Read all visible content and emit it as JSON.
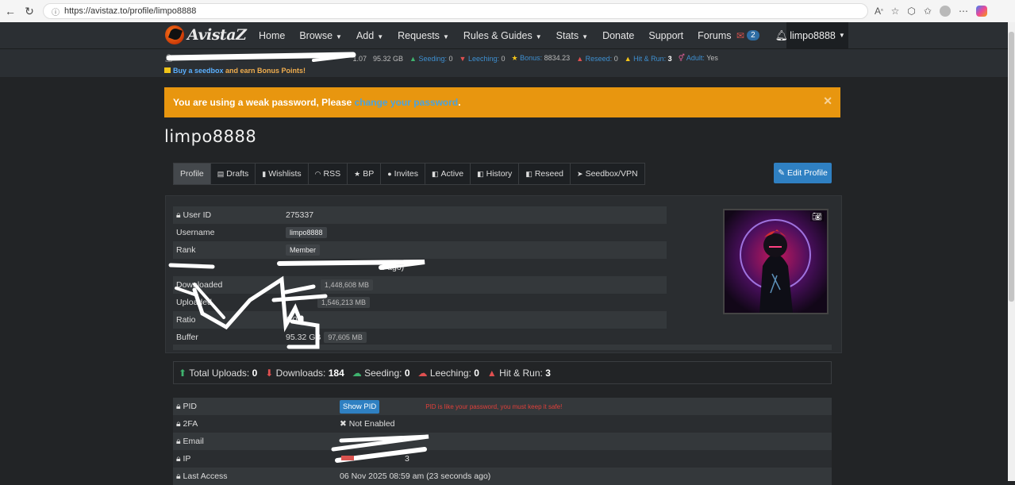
{
  "browser": {
    "url": "https://avistaz.to/profile/limpo8888"
  },
  "site": {
    "logo_text": "AvistaZ",
    "menu": [
      {
        "label": "Home",
        "caret": false
      },
      {
        "label": "Browse",
        "caret": true
      },
      {
        "label": "Add",
        "caret": true
      },
      {
        "label": "Requests",
        "caret": true
      },
      {
        "label": "Rules & Guides",
        "caret": true
      },
      {
        "label": "Stats",
        "caret": true
      },
      {
        "label": "Donate",
        "caret": false
      },
      {
        "label": "Support",
        "caret": false
      },
      {
        "label": "Forums",
        "caret": false
      }
    ],
    "mail_count": "2",
    "username": "limpo8888"
  },
  "stats": {
    "ratio": "1.07",
    "buffer": "95.32 GB",
    "seeding_label": "Seeding:",
    "seeding_value": "0",
    "leeching_label": "Leeching:",
    "leeching_value": "0",
    "bonus_label": "Bonus:",
    "bonus_value": "8834.23",
    "reseed_label": "Reseed:",
    "reseed_value": "0",
    "hitrun_label": "Hit & Run:",
    "hitrun_value": "3",
    "adult_label": "Adult:",
    "adult_value": "Yes",
    "seedbox_link": "Buy a seedbox",
    "seedbox_rest": "and earn Bonus Points!"
  },
  "alert": {
    "text_before": "You are using a weak password, Please ",
    "link": "change your password",
    "text_after": "."
  },
  "page_title": "limpo8888",
  "tabs": [
    {
      "label": "Profile",
      "icon": "",
      "active": true
    },
    {
      "label": "Drafts",
      "icon": "▤",
      "active": false
    },
    {
      "label": "Wishlists",
      "icon": "▮",
      "active": false
    },
    {
      "label": "RSS",
      "icon": "◠",
      "active": false
    },
    {
      "label": "BP",
      "icon": "★",
      "active": false
    },
    {
      "label": "Invites",
      "icon": "●",
      "active": false
    },
    {
      "label": "Active",
      "icon": "◧",
      "active": false
    },
    {
      "label": "History",
      "icon": "◧",
      "active": false
    },
    {
      "label": "Reseed",
      "icon": "◧",
      "active": false
    },
    {
      "label": "Seedbox/VPN",
      "icon": "➤",
      "active": false
    }
  ],
  "edit_profile": "Edit Profile",
  "profile": {
    "user_id_label": "User ID",
    "user_id": "275337",
    "username_label": "Username",
    "username": "limpo8888",
    "rank_label": "Rank",
    "rank": "Member",
    "joined_suffix": "s ago)",
    "downloaded_label": "Downloaded",
    "downloaded_mb": "1,448,608 MB",
    "uploaded_label": "Uploaded",
    "uploaded_mb": "1,546,213 MB",
    "ratio_label": "Ratio",
    "ratio": "1.07",
    "buffer_label": "Buffer",
    "buffer": "95.32 GB",
    "buffer_mb": "97,605 MB"
  },
  "totals": {
    "uploads_label": "Total Uploads:",
    "uploads": "0",
    "downloads_label": "Downloads:",
    "downloads": "184",
    "seeding_label": "Seeding:",
    "seeding": "0",
    "leeching_label": "Leeching:",
    "leeching": "0",
    "hitrun_label": "Hit & Run:",
    "hitrun": "3"
  },
  "security": {
    "pid_label": "PID",
    "show_pid": "Show PID",
    "pid_note": "PID is like your password, you must keep it safe!",
    "twofa_label": "2FA",
    "twofa_value": "Not Enabled",
    "email_label": "Email",
    "ip_label": "IP",
    "ip_tail": "3",
    "last_access_label": "Last Access",
    "last_access": "06 Nov 2025 08:59 am (23 seconds ago)"
  },
  "colors": {
    "navbar": "#2b2f33",
    "page_bg": "#222426",
    "alert_bg": "#e8960f",
    "accent_blue": "#2f80c2",
    "danger": "#e05050"
  }
}
